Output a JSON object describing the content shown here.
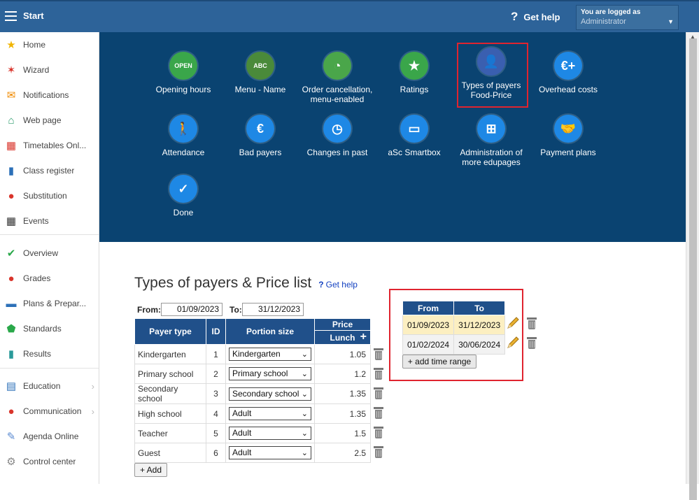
{
  "topbar": {
    "title": "Start",
    "help": "Get help",
    "logged_line1": "You are logged as",
    "logged_line2": "Administrator"
  },
  "sidebar": {
    "items": [
      {
        "label": "Home",
        "icon": "star-icon",
        "color": "#f0b400"
      },
      {
        "label": "Wizard",
        "icon": "wand-icon",
        "color": "#d9342b"
      },
      {
        "label": "Notifications",
        "icon": "envelope-icon",
        "color": "#f08a00"
      },
      {
        "label": "Web page",
        "icon": "house-icon",
        "color": "#2a9a6b"
      },
      {
        "label": "Timetables Onl...",
        "icon": "grid-icon",
        "color": "#d9342b"
      },
      {
        "label": "Class register",
        "icon": "book-icon",
        "color": "#2c70b8"
      },
      {
        "label": "Substitution",
        "icon": "person-icon",
        "color": "#d9342b"
      },
      {
        "label": "Events",
        "icon": "calendar-icon",
        "color": "#333"
      },
      {
        "label": "Overview",
        "icon": "check-circle-icon",
        "color": "#2aa84a"
      },
      {
        "label": "Grades",
        "icon": "grade-icon",
        "color": "#d9342b"
      },
      {
        "label": "Plans & Prepar...",
        "icon": "briefcase-icon",
        "color": "#2c70b8"
      },
      {
        "label": "Standards",
        "icon": "shield-icon",
        "color": "#2aa84a"
      },
      {
        "label": "Results",
        "icon": "bar-chart-icon",
        "color": "#2a9a9a"
      },
      {
        "label": "Education",
        "icon": "books-icon",
        "color": "#2c70b8"
      },
      {
        "label": "Communication",
        "icon": "chat-icon",
        "color": "#d9342b"
      },
      {
        "label": "Agenda Online",
        "icon": "pen-icon",
        "color": "#5a8ad0"
      },
      {
        "label": "Control center",
        "icon": "gear-icon",
        "color": "#888"
      }
    ]
  },
  "tiles": [
    {
      "label": "Opening hours",
      "icon": "open-sign-icon",
      "color": "#3aa64a",
      "glyph": "OPEN"
    },
    {
      "label": "Menu - Name",
      "icon": "abc-badge-icon",
      "color": "#4a8a3a",
      "glyph": "ABC"
    },
    {
      "label": "Order cancellation, menu-enabled",
      "icon": "clock-icon",
      "color": "#4aa64a",
      "glyph": "◔"
    },
    {
      "label": "Ratings",
      "icon": "star-icon",
      "color": "#3aa64a",
      "glyph": "★"
    },
    {
      "label": "Types of payers Food-Price",
      "icon": "payer-icon",
      "color": "#3a5fb0",
      "glyph": "👤"
    },
    {
      "label": "Overhead costs",
      "icon": "euro-plus-icon",
      "color": "#1e88e5",
      "glyph": "€+"
    },
    {
      "label": "Attendance",
      "icon": "walking-icon",
      "color": "#1e88e5",
      "glyph": "🚶"
    },
    {
      "label": "Bad payers",
      "icon": "money-bag-icon",
      "color": "#1e88e5",
      "glyph": "€"
    },
    {
      "label": "Changes in past",
      "icon": "history-clock-icon",
      "color": "#1e88e5",
      "glyph": "◷"
    },
    {
      "label": "aSc Smartbox",
      "icon": "monitor-icon",
      "color": "#1e88e5",
      "glyph": "▭"
    },
    {
      "label": "Administration of more edupages",
      "icon": "hierarchy-icon",
      "color": "#1e88e5",
      "glyph": "⊞"
    },
    {
      "label": "Payment plans",
      "icon": "handshake-icon",
      "color": "#1e88e5",
      "glyph": "🤝"
    },
    {
      "label": "Done",
      "icon": "checkmark-icon",
      "color": "#1e88e5",
      "glyph": "✓"
    }
  ],
  "page": {
    "title": "Types of payers & Price list",
    "help": "Get help",
    "from_label": "From:",
    "to_label": "To:",
    "from_value": "01/09/2023",
    "to_value": "31/12/2023",
    "add_label": "+ Add"
  },
  "payers": {
    "headers": {
      "payer_type": "Payer type",
      "id": "ID",
      "portion": "Portion size",
      "price": "Price",
      "lunch": "Lunch"
    },
    "rows": [
      {
        "type": "Kindergarten",
        "id": "1",
        "portion": "Kindergarten",
        "price": "1.05"
      },
      {
        "type": "Primary school",
        "id": "2",
        "portion": "Primary school",
        "price": "1.2"
      },
      {
        "type": "Secondary school",
        "id": "3",
        "portion": "Secondary school",
        "price": "1.35"
      },
      {
        "type": "High school",
        "id": "4",
        "portion": "Adult",
        "price": "1.35"
      },
      {
        "type": "Teacher",
        "id": "5",
        "portion": "Adult",
        "price": "1.5"
      },
      {
        "type": "Guest",
        "id": "6",
        "portion": "Adult",
        "price": "2.5"
      }
    ]
  },
  "ranges": {
    "headers": {
      "from": "From",
      "to": "To"
    },
    "rows": [
      {
        "from": "01/09/2023",
        "to": "31/12/2023"
      },
      {
        "from": "01/02/2024",
        "to": "30/06/2024"
      }
    ],
    "add_label": "+ add time range"
  },
  "colors": {
    "topbar": "#2d6399",
    "panel": "#0a4371",
    "header": "#20508a",
    "highlight": "#e0242f",
    "selected_row": "#fcefc1"
  }
}
